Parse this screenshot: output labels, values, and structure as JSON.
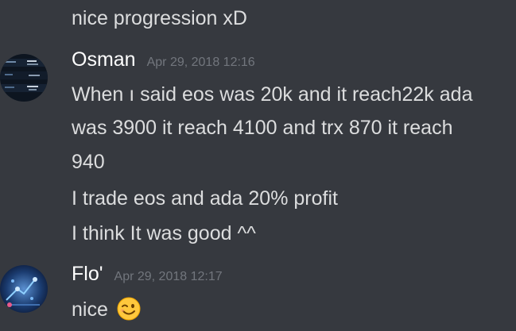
{
  "messages": {
    "prev_line": "nice progression xD",
    "osman": {
      "username": "Osman",
      "timestamp": "Apr 29, 2018 12:16",
      "lines": [
        "When ı said eos was 20k and it reach22k ada",
        "was 3900 it reach 4100 and trx 870 it reach",
        "940",
        "I trade eos and ada 20% profit",
        "I think It was good ^^"
      ]
    },
    "flo": {
      "username": "Flo'",
      "timestamp": "Apr 29, 2018 12:17",
      "text": "nice",
      "emoji": "winking-face-emoji"
    }
  },
  "colors": {
    "background": "#36393f",
    "message_text": "#dcddde",
    "username": "#ffffff",
    "timestamp": "#72767d",
    "emoji_yellow": "#ffc83d"
  },
  "icons": {
    "osman_avatar": "crypto-chart-avatar",
    "flo_avatar": "circuit-avatar"
  }
}
